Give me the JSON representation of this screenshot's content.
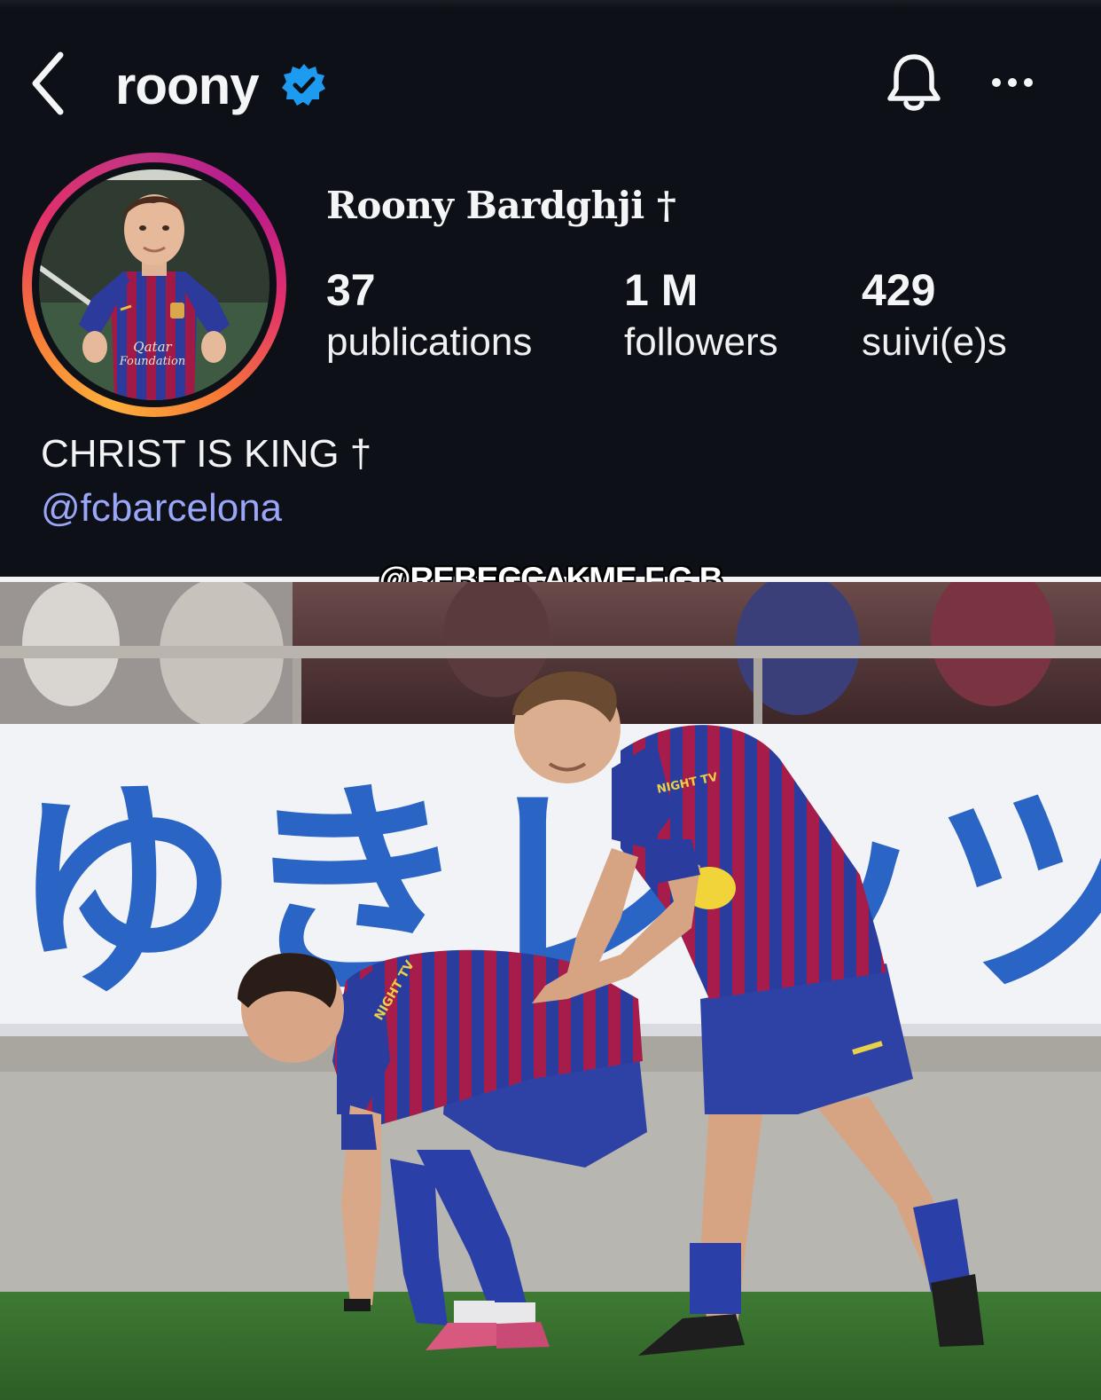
{
  "header": {
    "username": "roony",
    "back_icon": "chevron-left-icon",
    "verified_icon": "verified-badge-icon",
    "bell_icon": "bell-icon",
    "more_icon": "more-horizontal-icon"
  },
  "profile": {
    "display_name": "Roony Bardghji †",
    "avatar_jersey_text": [
      "Qatar",
      "Foundation"
    ]
  },
  "stats": [
    {
      "value": "37",
      "label": "publications"
    },
    {
      "value": "1 M",
      "label": "followers"
    },
    {
      "value": "429",
      "label": "suivi(e)s"
    }
  ],
  "bio": {
    "text": "CHRIST IS KING †",
    "link": "@fcbarcelona"
  },
  "watermark": "@REBECCAKME F.C.B",
  "photo": {
    "banner_text": "ゆきレッツー",
    "sponsor_text": "NIGHT TV"
  },
  "colors": {
    "background": "#0d1016",
    "link": "#9aa6f8",
    "verified": "#1d9bf0",
    "jersey_blue": "#27389a",
    "jersey_red": "#9e1a46"
  }
}
